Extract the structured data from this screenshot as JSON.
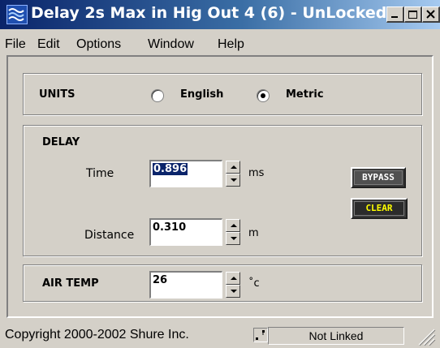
{
  "window": {
    "title": "Delay 2s Max in Hig Out 4 (6) - UnLocked",
    "controls": [
      "minimize-icon",
      "maximize-icon",
      "close-icon"
    ]
  },
  "menu": [
    {
      "label": "File"
    },
    {
      "label": "Edit"
    },
    {
      "label": "Options"
    },
    {
      "label": "Window"
    },
    {
      "label": "Help"
    }
  ],
  "units": {
    "label": "UNITS",
    "options": [
      {
        "label": "English",
        "selected": false
      },
      {
        "label": "Metric",
        "selected": true
      }
    ]
  },
  "delay": {
    "label": "DELAY",
    "time": {
      "label": "Time",
      "value": "0.896",
      "unit": "ms"
    },
    "distance": {
      "label": "Distance",
      "value": "0.310",
      "unit": "m"
    },
    "bypass_label": "BYPASS",
    "clear_label": "CLEAR"
  },
  "air_temp": {
    "label": "AIR TEMP",
    "value": "26",
    "unit": "˚c"
  },
  "status": {
    "copyright": "Copyright 2000-2002 Shure Inc.",
    "link_status": "Not Linked"
  },
  "colors": {
    "face": "#d4d0c8",
    "title_start": "#0a246a",
    "title_end": "#a6caf0",
    "clear_text": "#ffff00",
    "selection": "#0a246a"
  }
}
